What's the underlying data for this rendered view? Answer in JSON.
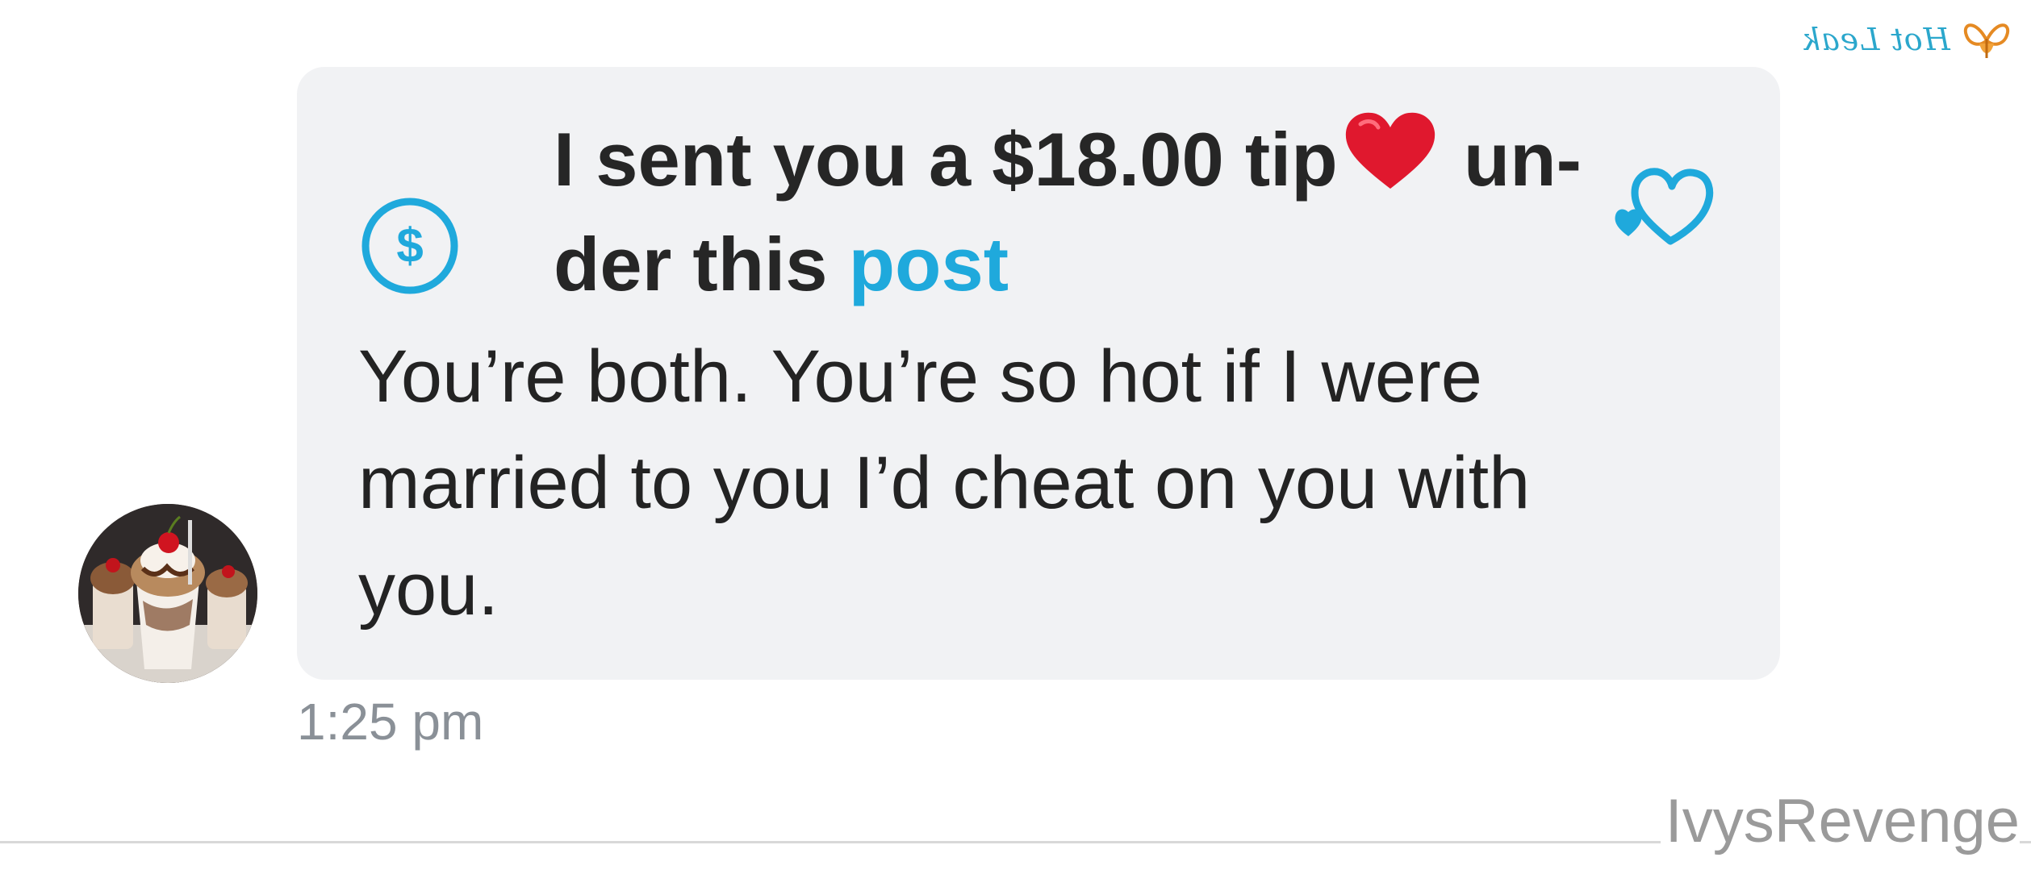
{
  "watermark": {
    "text": "Hot Leak",
    "logo_icon": "butterfly-icon"
  },
  "message": {
    "avatar_icon": "dessert-avatar",
    "tip": {
      "prefix": "I sent you a $18.00 tip",
      "emoji": "red-heart-icon",
      "suffix_part1": "un-",
      "suffix_part2": "der this",
      "link_text": "post",
      "currency_icon": "dollar-circle-icon",
      "like_icon": "heart-outline-icon"
    },
    "body_lines": [
      "You’re both. You’re so hot if I were",
      "married to you I’d cheat on you with",
      "you."
    ],
    "timestamp": "1:25 pm"
  },
  "footer": {
    "author": "IvysRevenge"
  },
  "colors": {
    "accent": "#1fa9dc",
    "bubble_bg": "#f1f2f4",
    "text": "#232323",
    "timestamp": "#8a9097",
    "heart": "#e0182e"
  }
}
